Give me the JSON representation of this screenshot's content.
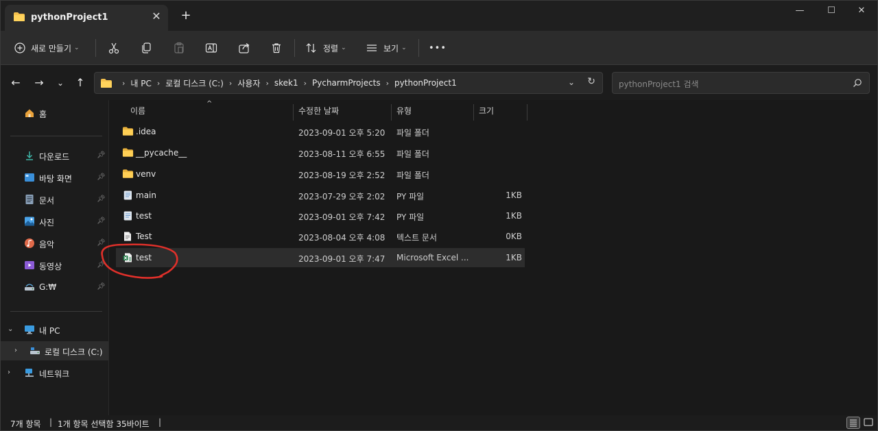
{
  "window": {
    "tab_title": "pythonProject1",
    "tab_close": "✕",
    "new_tab": "+",
    "controls": {
      "minimize": "—",
      "maximize": "☐",
      "close": "✕"
    }
  },
  "toolbar": {
    "new_label": "새로 만들기",
    "sort_label": "정렬",
    "view_label": "보기",
    "more": "•••"
  },
  "address": {
    "breadcrumbs": [
      "내 PC",
      "로컬 디스크 (C:)",
      "사용자",
      "skek1",
      "PycharmProjects",
      "pythonProject1"
    ],
    "search_placeholder": "pythonProject1 검색"
  },
  "sidebar": {
    "home": "홈",
    "quick": [
      {
        "label": "다운로드",
        "icon": "download-icon"
      },
      {
        "label": "바탕 화면",
        "icon": "desktop-icon"
      },
      {
        "label": "문서",
        "icon": "documents-icon"
      },
      {
        "label": "사진",
        "icon": "pictures-icon"
      },
      {
        "label": "음악",
        "icon": "music-icon"
      },
      {
        "label": "동영상",
        "icon": "videos-icon"
      },
      {
        "label": "G:₩",
        "icon": "network-drive-icon"
      }
    ],
    "this_pc": "내 PC",
    "local_disk": "로컬 디스크 (C:)",
    "network": "네트워크"
  },
  "columns": {
    "name": "이름",
    "modified": "수정한 날짜",
    "type": "유형",
    "size": "크기"
  },
  "files": [
    {
      "name": ".idea",
      "modified": "2023-09-01 오후 5:20",
      "type": "파일 폴더",
      "size": "",
      "icon": "folder-icon"
    },
    {
      "name": "__pycache__",
      "modified": "2023-08-11 오후 6:55",
      "type": "파일 폴더",
      "size": "",
      "icon": "folder-icon"
    },
    {
      "name": "venv",
      "modified": "2023-08-19 오후 2:52",
      "type": "파일 폴더",
      "size": "",
      "icon": "folder-icon"
    },
    {
      "name": "main",
      "modified": "2023-07-29 오후 2:02",
      "type": "PY 파일",
      "size": "1KB",
      "icon": "python-file-icon"
    },
    {
      "name": "test",
      "modified": "2023-09-01 오후 7:42",
      "type": "PY 파일",
      "size": "1KB",
      "icon": "python-file-icon"
    },
    {
      "name": "Test",
      "modified": "2023-08-04 오후 4:08",
      "type": "텍스트 문서",
      "size": "0KB",
      "icon": "text-file-icon"
    },
    {
      "name": "test",
      "modified": "2023-09-01 오후 7:47",
      "type": "Microsoft Excel ...",
      "size": "1KB",
      "icon": "excel-file-icon",
      "selected": true
    }
  ],
  "status": {
    "item_count": "7개 항목",
    "selection": "1개 항목 선택함 35바이트"
  }
}
